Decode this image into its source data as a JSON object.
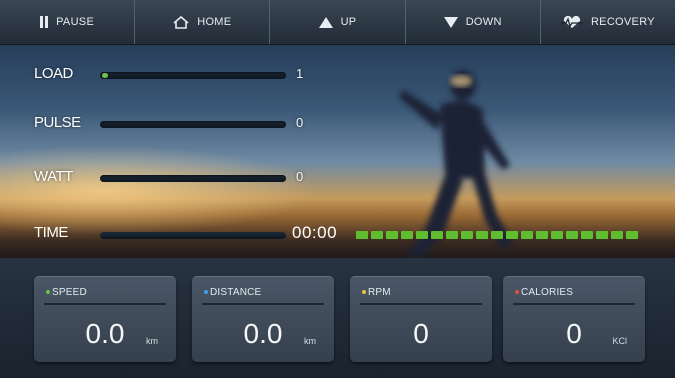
{
  "toolbar": {
    "pause": "PAUSE",
    "home": "HOME",
    "up": "UP",
    "down": "DOWN",
    "recovery": "RECOVERY"
  },
  "metrics": {
    "load": {
      "label": "LOAD",
      "value": "1"
    },
    "pulse": {
      "label": "PULSE",
      "value": "0"
    },
    "watt": {
      "label": "WATT",
      "value": "0"
    }
  },
  "time": {
    "label": "TIME",
    "value": "00:00",
    "progress_segments": 19
  },
  "cards": {
    "speed": {
      "title": "SPEED",
      "value": "0.0",
      "unit": "km"
    },
    "distance": {
      "title": "DISTANCE",
      "value": "0.0",
      "unit": "km"
    },
    "rpm": {
      "title": "RPM",
      "value": "0",
      "unit": ""
    },
    "calories": {
      "title": "CALORIES",
      "value": "0",
      "unit": "KCl"
    }
  },
  "colors": {
    "accent_green": "#5fbe2f",
    "speed_dot": "#6ec246",
    "distance_dot": "#3fa2e8",
    "rpm_dot": "#e8c43a",
    "calories_dot": "#e0503a"
  },
  "icons": [
    "pause-icon",
    "home-icon",
    "up-arrow-icon",
    "down-arrow-icon",
    "heart-recovery-icon"
  ]
}
